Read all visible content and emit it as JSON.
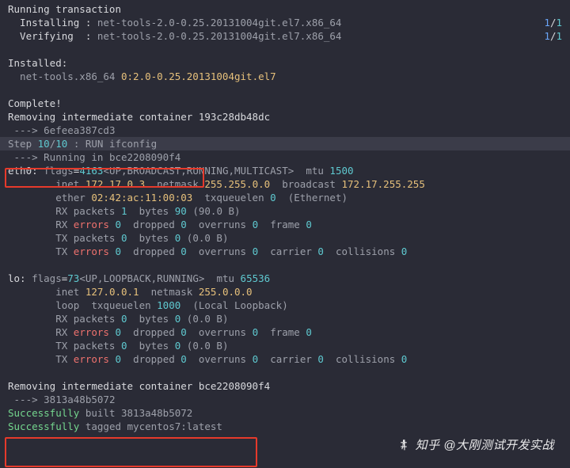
{
  "transaction": {
    "header": "Running transaction",
    "install_label": "  Installing : ",
    "verify_label": "  Verifying  : ",
    "pkg_full": "net-tools-2.0-0.25.20131004git.el7.x86_64",
    "count_cur": "1",
    "count_total": "1",
    "installed_header": "Installed:",
    "installed_pkg_name": "  net-tools.x86_64 ",
    "installed_pkg_ver": "0:2.0-0.25.20131004git.el7",
    "complete": "Complete!"
  },
  "bridge1": {
    "removing": "Removing intermediate container 193c28db48dc",
    "arrow": " ---> ",
    "hash": "6efeea387cd3"
  },
  "step": {
    "label": "Step ",
    "num": "10",
    "sep": "/",
    "total": "10",
    "cmd": " : RUN ifconfig"
  },
  "running": {
    "arrow": " ---> ",
    "label": "Running in",
    "id": " bce2208090f4"
  },
  "ifaces": {
    "eth0": {
      "name": "eth0: ",
      "flags_lbl": "flags",
      "flags_eq": "=",
      "flags_n": "4163",
      "flags_txt": "<UP,BROADCAST,RUNNING,MULTICAST>",
      "mtu_lbl": "  mtu ",
      "mtu": "1500",
      "inet_lbl": "        inet ",
      "inet": "172.17.0.3",
      "mask_lbl": "  netmask ",
      "mask": "255.255.0.0",
      "bcast_lbl": "  broadcast ",
      "bcast": "172.17.255.255",
      "ether_lbl": "        ether ",
      "ether": "02:42:ac:11:00:03",
      "txq_lbl": "  txqueuelen ",
      "txq": "0",
      "txq_sfx": "  (Ethernet)",
      "rxp": "        RX packets ",
      "rxp_n": "1",
      "rxb": "  bytes ",
      "rxb_n": "90",
      "rxb_p": " (90.0 B)",
      "rxerr": "        RX ",
      "err_lbl": "errors ",
      "drop_lbl": "  dropped ",
      "over_lbl": "  overruns ",
      "frame_lbl": "  frame ",
      "txp": "        TX packets ",
      "txb_n": "0",
      "txb_p": " (0.0 B)",
      "carr_lbl": "  carrier ",
      "coll_lbl": "  collisions "
    },
    "lo": {
      "name": "lo: ",
      "flags_n": "73",
      "flags_txt": "<UP,LOOPBACK,RUNNING>",
      "mtu": "65536",
      "inet": "127.0.0.1",
      "mask": "255.0.0.0",
      "loop_lbl": "        loop  txqueuelen ",
      "txq": "1000",
      "loop_sfx": "  (Local Loopback)"
    },
    "zero": "0"
  },
  "bridge2": {
    "removing": "Removing intermediate container bce2208090f4",
    "arrow": " ---> ",
    "hash": "3813a48b5072"
  },
  "success": {
    "built_lbl": "Successfully",
    "built_txt": " built 3813a48b5072",
    "tagged_txt": " tagged mycentos7:latest"
  },
  "watermark": "知乎 @大刚测试开发实战"
}
